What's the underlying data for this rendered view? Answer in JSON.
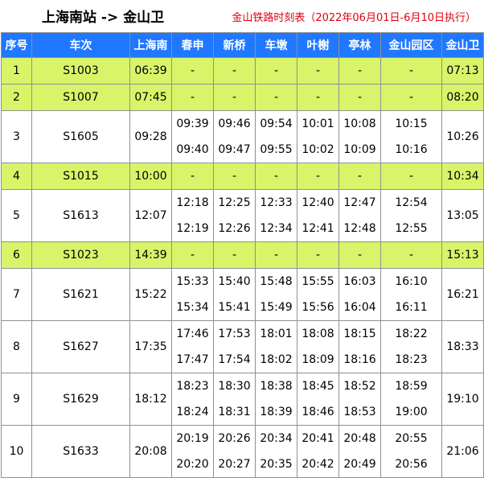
{
  "header": {
    "route": "上海南站 -> 金山卫",
    "subtitle": "金山铁路时刻表（2022年06月01日-6月10日执行）"
  },
  "colors": {
    "header_bg": "#1f78ff",
    "express_row_bg": "#d9f469",
    "subtitle_color": "#e0000d"
  },
  "columns": [
    "序号",
    "车次",
    "上海南",
    "春申",
    "新桥",
    "车墩",
    "叶榭",
    "亭林",
    "金山园区",
    "金山卫"
  ],
  "rows": [
    {
      "no": "1",
      "train": "S1003",
      "shanghainan": "06:39",
      "express": true,
      "stops": [
        "-",
        "-",
        "-",
        "-",
        "-",
        "-"
      ],
      "jinshanwei": "07:13"
    },
    {
      "no": "2",
      "train": "S1007",
      "shanghainan": "07:45",
      "express": true,
      "stops": [
        "-",
        "-",
        "-",
        "-",
        "-",
        "-"
      ],
      "jinshanwei": "08:20"
    },
    {
      "no": "3",
      "train": "S1605",
      "shanghainan": "09:28",
      "express": false,
      "stops": [
        [
          "09:39",
          "09:40"
        ],
        [
          "09:46",
          "09:47"
        ],
        [
          "09:54",
          "09:55"
        ],
        [
          "10:01",
          "10:02"
        ],
        [
          "10:08",
          "10:09"
        ],
        [
          "10:15",
          "10:16"
        ]
      ],
      "jinshanwei": "10:26"
    },
    {
      "no": "4",
      "train": "S1015",
      "shanghainan": "10:00",
      "express": true,
      "stops": [
        "-",
        "-",
        "-",
        "-",
        "-",
        "-"
      ],
      "jinshanwei": "10:34"
    },
    {
      "no": "5",
      "train": "S1613",
      "shanghainan": "12:07",
      "express": false,
      "stops": [
        [
          "12:18",
          "12:19"
        ],
        [
          "12:25",
          "12:26"
        ],
        [
          "12:33",
          "12:34"
        ],
        [
          "12:40",
          "12:41"
        ],
        [
          "12:47",
          "12:48"
        ],
        [
          "12:54",
          "12:55"
        ]
      ],
      "jinshanwei": "13:05"
    },
    {
      "no": "6",
      "train": "S1023",
      "shanghainan": "14:39",
      "express": true,
      "stops": [
        "-",
        "-",
        "-",
        "-",
        "-",
        "-"
      ],
      "jinshanwei": "15:13"
    },
    {
      "no": "7",
      "train": "S1621",
      "shanghainan": "15:22",
      "express": false,
      "stops": [
        [
          "15:33",
          "15:34"
        ],
        [
          "15:40",
          "15:41"
        ],
        [
          "15:48",
          "15:49"
        ],
        [
          "15:55",
          "15:56"
        ],
        [
          "16:03",
          "16:04"
        ],
        [
          "16:10",
          "16:11"
        ]
      ],
      "jinshanwei": "16:21"
    },
    {
      "no": "8",
      "train": "S1627",
      "shanghainan": "17:35",
      "express": false,
      "stops": [
        [
          "17:46",
          "17:47"
        ],
        [
          "17:53",
          "17:54"
        ],
        [
          "18:01",
          "18:02"
        ],
        [
          "18:08",
          "18:09"
        ],
        [
          "18:15",
          "18:16"
        ],
        [
          "18:22",
          "18:23"
        ]
      ],
      "jinshanwei": "18:33"
    },
    {
      "no": "9",
      "train": "S1629",
      "shanghainan": "18:12",
      "express": false,
      "stops": [
        [
          "18:23",
          "18:24"
        ],
        [
          "18:30",
          "18:31"
        ],
        [
          "18:38",
          "18:39"
        ],
        [
          "18:45",
          "18:46"
        ],
        [
          "18:52",
          "18:53"
        ],
        [
          "18:59",
          "19:00"
        ]
      ],
      "jinshanwei": "19:10"
    },
    {
      "no": "10",
      "train": "S1633",
      "shanghainan": "20:08",
      "express": false,
      "stops": [
        [
          "20:19",
          "20:20"
        ],
        [
          "20:26",
          "20:27"
        ],
        [
          "20:34",
          "20:35"
        ],
        [
          "20:41",
          "20:42"
        ],
        [
          "20:48",
          "20:49"
        ],
        [
          "20:55",
          "20:56"
        ]
      ],
      "jinshanwei": "21:06"
    }
  ]
}
